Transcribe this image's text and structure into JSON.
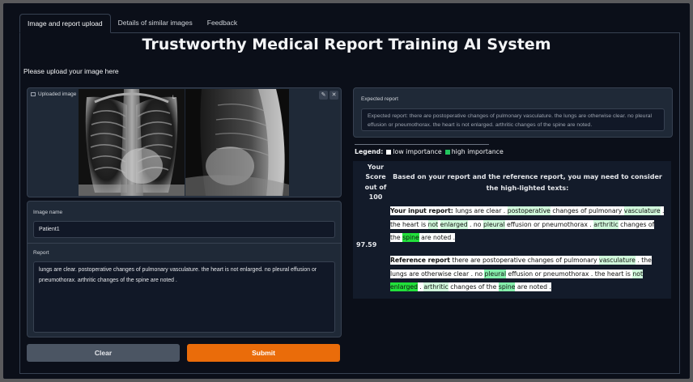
{
  "tabs": [
    {
      "label": "Image and report upload",
      "active": true
    },
    {
      "label": "Details of similar images",
      "active": false
    },
    {
      "label": "Feedback",
      "active": false
    }
  ],
  "title": "Trustworthy Medical Report Training AI System",
  "upload_prompt": "Please upload your image here",
  "uploaded_image": {
    "label": "Uploaded image",
    "edit_icon": "pencil-icon",
    "close_icon": "close-icon"
  },
  "image_name": {
    "label": "Image name",
    "value": "Patient1"
  },
  "report": {
    "label": "Report",
    "value": "lungs are clear. postoperative changes of pulmonary vasculature. the heart is not enlarged. no pleural effusion or pneumothorax. arthritic changes of the spine are noted ."
  },
  "buttons": {
    "clear": "Clear",
    "submit": "Submit"
  },
  "expected_report": {
    "label": "Expected report",
    "text": "Expected report: there are postoperative changes of pulmonary vasculature. the lungs are otherwise clear. no pleural effusion or pneumothorax. the heart is not enlarged. arthritic changes of the spine are noted."
  },
  "legend": {
    "title": "Legend:",
    "low": "low importance",
    "high": "high importance",
    "low_color": "#ffffff",
    "high_color": "#22c55e"
  },
  "score": {
    "header": [
      "Your",
      "Score",
      "out of",
      "100"
    ],
    "value": "97.59"
  },
  "intro": "Based on your report and the reference report, you may need to consider the high-lighted texts:",
  "colors": {
    "white": "#ffffff",
    "light_green": "#d1fadc",
    "mid_green": "#86efac",
    "bright_green": "#22e03b"
  },
  "input_report": {
    "segments": [
      {
        "text": "Your input report:",
        "level": "white",
        "bold": true
      },
      {
        "text": " lungs are clear . ",
        "level": "white"
      },
      {
        "text": "postoperative",
        "level": "light_green"
      },
      {
        "text": " changes of pulmonary ",
        "level": "white"
      },
      {
        "text": "vasculature",
        "level": "light_green"
      },
      {
        "text": " . the heart is ",
        "level": "white"
      },
      {
        "text": "not",
        "level": "light_green"
      },
      {
        "text": " ",
        "level": "white"
      },
      {
        "text": "enlarged",
        "level": "light_green"
      },
      {
        "text": " . no ",
        "level": "white"
      },
      {
        "text": "pleural",
        "level": "light_green"
      },
      {
        "text": " effusion or pneumothorax . ",
        "level": "white"
      },
      {
        "text": "arthritic",
        "level": "light_green"
      },
      {
        "text": " changes of the ",
        "level": "white"
      },
      {
        "text": "spine",
        "level": "bright_green"
      },
      {
        "text": " are noted . ",
        "level": "white"
      }
    ]
  },
  "reference_report": {
    "segments": [
      {
        "text": "Reference report",
        "level": "white",
        "bold": true
      },
      {
        "text": " there are postoperative changes of pulmonary ",
        "level": "white"
      },
      {
        "text": "vasculature",
        "level": "light_green"
      },
      {
        "text": " . the lungs are otherwise clear . no ",
        "level": "white"
      },
      {
        "text": "pleural",
        "level": "mid_green"
      },
      {
        "text": " effusion or pneumothorax . the heart is ",
        "level": "white"
      },
      {
        "text": "not",
        "level": "light_green"
      },
      {
        "text": " ",
        "level": "white"
      },
      {
        "text": "enlarged",
        "level": "bright_green"
      },
      {
        "text": " . ",
        "level": "white"
      },
      {
        "text": "arthritic",
        "level": "light_green"
      },
      {
        "text": " changes of the ",
        "level": "white"
      },
      {
        "text": "spine",
        "level": "mid_green"
      },
      {
        "text": " are noted . ",
        "level": "white"
      }
    ]
  }
}
